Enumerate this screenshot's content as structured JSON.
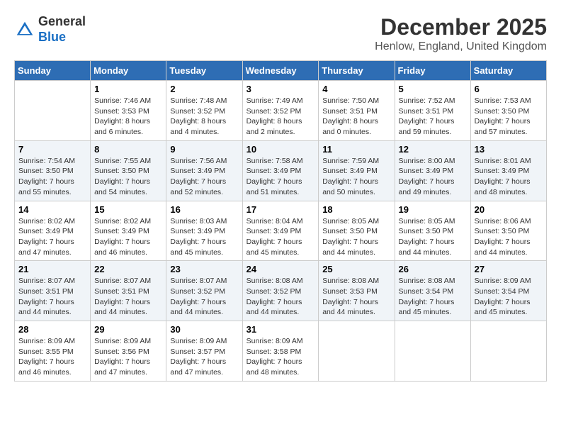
{
  "header": {
    "logo_line1": "General",
    "logo_line2": "Blue",
    "main_title": "December 2025",
    "subtitle": "Henlow, England, United Kingdom"
  },
  "days_of_week": [
    "Sunday",
    "Monday",
    "Tuesday",
    "Wednesday",
    "Thursday",
    "Friday",
    "Saturday"
  ],
  "weeks": [
    [
      {
        "day": "",
        "info": ""
      },
      {
        "day": "1",
        "info": "Sunrise: 7:46 AM\nSunset: 3:53 PM\nDaylight: 8 hours\nand 6 minutes."
      },
      {
        "day": "2",
        "info": "Sunrise: 7:48 AM\nSunset: 3:52 PM\nDaylight: 8 hours\nand 4 minutes."
      },
      {
        "day": "3",
        "info": "Sunrise: 7:49 AM\nSunset: 3:52 PM\nDaylight: 8 hours\nand 2 minutes."
      },
      {
        "day": "4",
        "info": "Sunrise: 7:50 AM\nSunset: 3:51 PM\nDaylight: 8 hours\nand 0 minutes."
      },
      {
        "day": "5",
        "info": "Sunrise: 7:52 AM\nSunset: 3:51 PM\nDaylight: 7 hours\nand 59 minutes."
      },
      {
        "day": "6",
        "info": "Sunrise: 7:53 AM\nSunset: 3:50 PM\nDaylight: 7 hours\nand 57 minutes."
      }
    ],
    [
      {
        "day": "7",
        "info": "Sunrise: 7:54 AM\nSunset: 3:50 PM\nDaylight: 7 hours\nand 55 minutes."
      },
      {
        "day": "8",
        "info": "Sunrise: 7:55 AM\nSunset: 3:50 PM\nDaylight: 7 hours\nand 54 minutes."
      },
      {
        "day": "9",
        "info": "Sunrise: 7:56 AM\nSunset: 3:49 PM\nDaylight: 7 hours\nand 52 minutes."
      },
      {
        "day": "10",
        "info": "Sunrise: 7:58 AM\nSunset: 3:49 PM\nDaylight: 7 hours\nand 51 minutes."
      },
      {
        "day": "11",
        "info": "Sunrise: 7:59 AM\nSunset: 3:49 PM\nDaylight: 7 hours\nand 50 minutes."
      },
      {
        "day": "12",
        "info": "Sunrise: 8:00 AM\nSunset: 3:49 PM\nDaylight: 7 hours\nand 49 minutes."
      },
      {
        "day": "13",
        "info": "Sunrise: 8:01 AM\nSunset: 3:49 PM\nDaylight: 7 hours\nand 48 minutes."
      }
    ],
    [
      {
        "day": "14",
        "info": "Sunrise: 8:02 AM\nSunset: 3:49 PM\nDaylight: 7 hours\nand 47 minutes."
      },
      {
        "day": "15",
        "info": "Sunrise: 8:02 AM\nSunset: 3:49 PM\nDaylight: 7 hours\nand 46 minutes."
      },
      {
        "day": "16",
        "info": "Sunrise: 8:03 AM\nSunset: 3:49 PM\nDaylight: 7 hours\nand 45 minutes."
      },
      {
        "day": "17",
        "info": "Sunrise: 8:04 AM\nSunset: 3:49 PM\nDaylight: 7 hours\nand 45 minutes."
      },
      {
        "day": "18",
        "info": "Sunrise: 8:05 AM\nSunset: 3:50 PM\nDaylight: 7 hours\nand 44 minutes."
      },
      {
        "day": "19",
        "info": "Sunrise: 8:05 AM\nSunset: 3:50 PM\nDaylight: 7 hours\nand 44 minutes."
      },
      {
        "day": "20",
        "info": "Sunrise: 8:06 AM\nSunset: 3:50 PM\nDaylight: 7 hours\nand 44 minutes."
      }
    ],
    [
      {
        "day": "21",
        "info": "Sunrise: 8:07 AM\nSunset: 3:51 PM\nDaylight: 7 hours\nand 44 minutes."
      },
      {
        "day": "22",
        "info": "Sunrise: 8:07 AM\nSunset: 3:51 PM\nDaylight: 7 hours\nand 44 minutes."
      },
      {
        "day": "23",
        "info": "Sunrise: 8:07 AM\nSunset: 3:52 PM\nDaylight: 7 hours\nand 44 minutes."
      },
      {
        "day": "24",
        "info": "Sunrise: 8:08 AM\nSunset: 3:52 PM\nDaylight: 7 hours\nand 44 minutes."
      },
      {
        "day": "25",
        "info": "Sunrise: 8:08 AM\nSunset: 3:53 PM\nDaylight: 7 hours\nand 44 minutes."
      },
      {
        "day": "26",
        "info": "Sunrise: 8:08 AM\nSunset: 3:54 PM\nDaylight: 7 hours\nand 45 minutes."
      },
      {
        "day": "27",
        "info": "Sunrise: 8:09 AM\nSunset: 3:54 PM\nDaylight: 7 hours\nand 45 minutes."
      }
    ],
    [
      {
        "day": "28",
        "info": "Sunrise: 8:09 AM\nSunset: 3:55 PM\nDaylight: 7 hours\nand 46 minutes."
      },
      {
        "day": "29",
        "info": "Sunrise: 8:09 AM\nSunset: 3:56 PM\nDaylight: 7 hours\nand 47 minutes."
      },
      {
        "day": "30",
        "info": "Sunrise: 8:09 AM\nSunset: 3:57 PM\nDaylight: 7 hours\nand 47 minutes."
      },
      {
        "day": "31",
        "info": "Sunrise: 8:09 AM\nSunset: 3:58 PM\nDaylight: 7 hours\nand 48 minutes."
      },
      {
        "day": "",
        "info": ""
      },
      {
        "day": "",
        "info": ""
      },
      {
        "day": "",
        "info": ""
      }
    ]
  ]
}
